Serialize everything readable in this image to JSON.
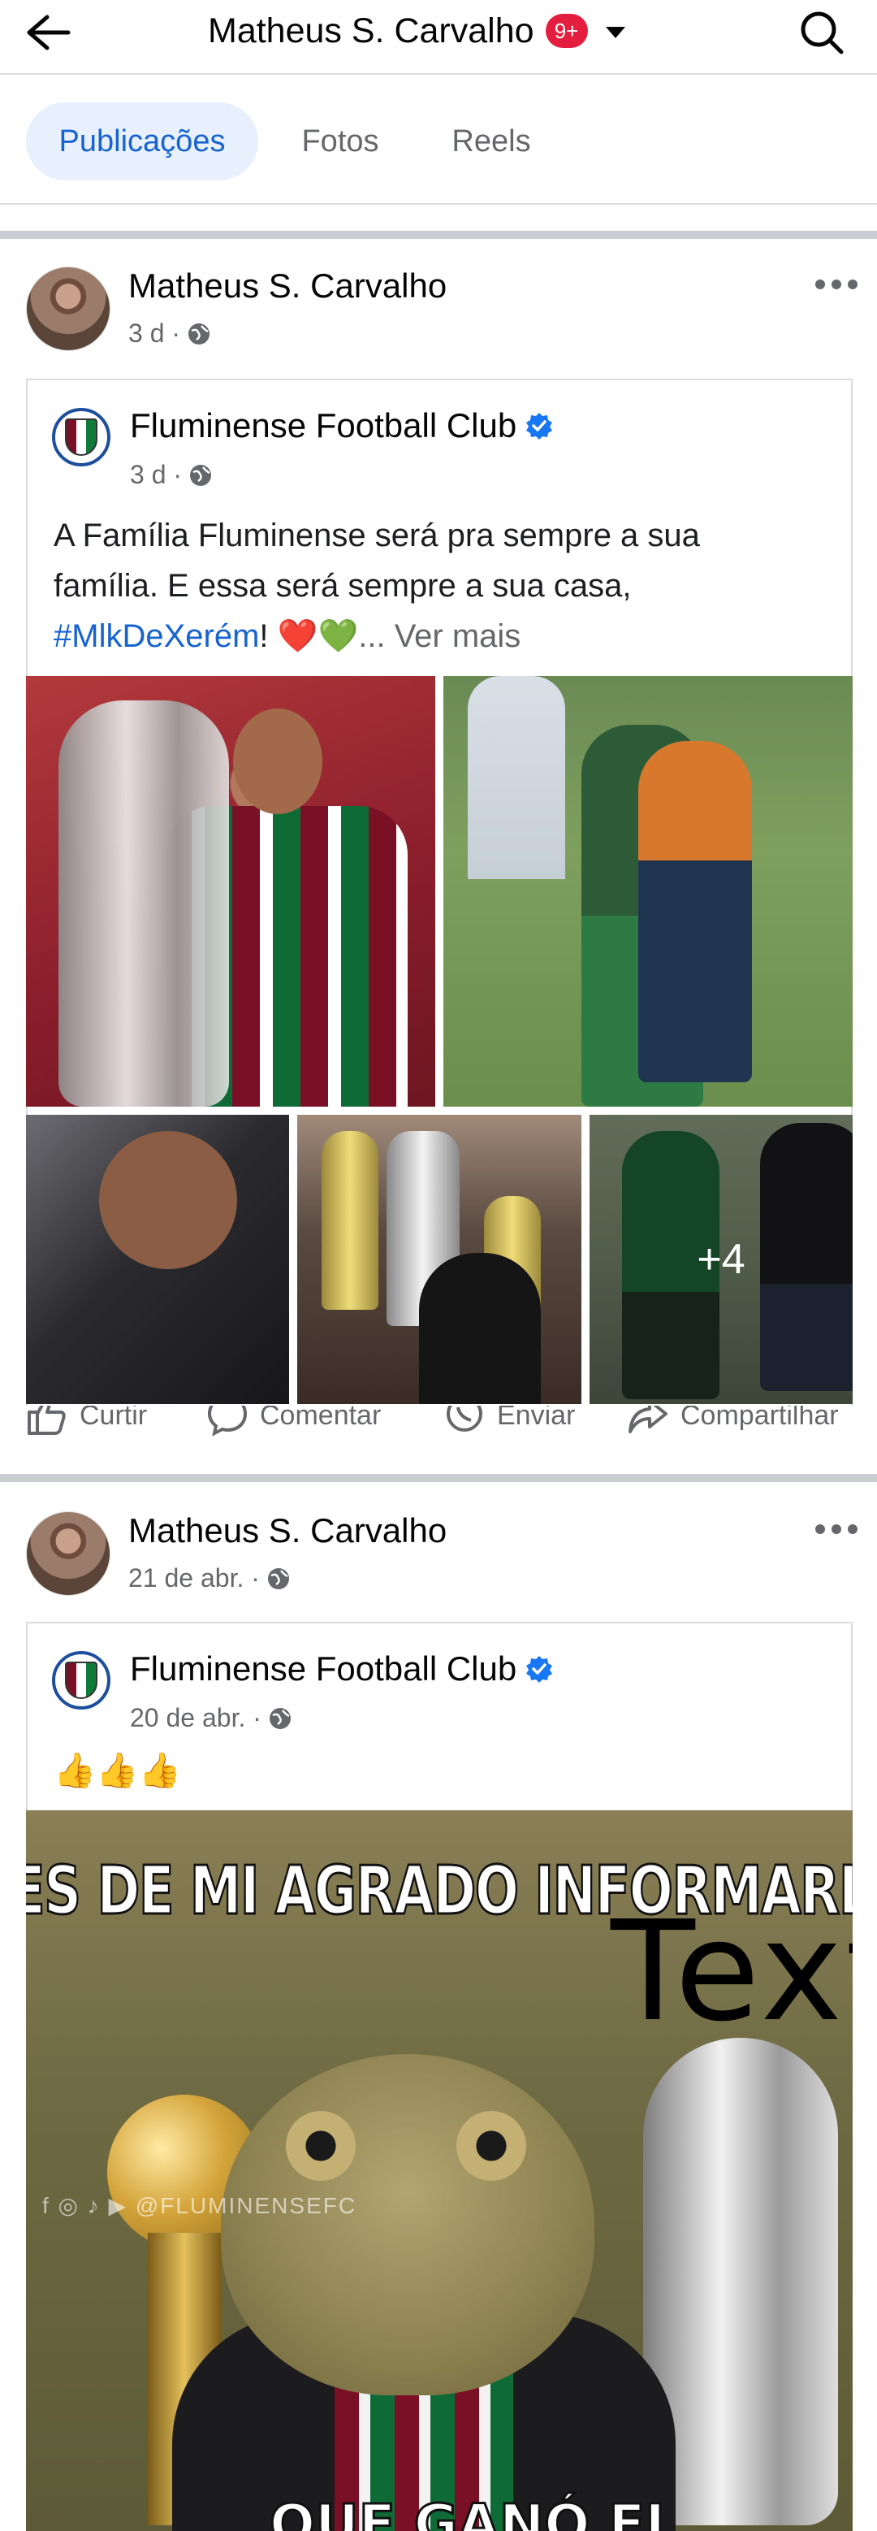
{
  "header": {
    "title": "Matheus S. Carvalho",
    "badge": "9+"
  },
  "tabs": [
    {
      "label": "Publicações",
      "active": true
    },
    {
      "label": "Fotos",
      "active": false
    },
    {
      "label": "Reels",
      "active": false
    }
  ],
  "posts": [
    {
      "author": "Matheus S. Carvalho",
      "time": "3 d ·",
      "shared": {
        "page": "Fluminense Football Club",
        "time": "3 d ·",
        "text_line1": "A Família Fluminense será pra sempre a sua",
        "text_line2": "família. E essa será sempre a sua casa,",
        "hashtag": "#MlkDeXerém",
        "after_hashtag": "! ❤️💚",
        "see_more": "... Ver mais",
        "more_photos": "+4"
      },
      "actions": [
        "Curtir",
        "Comentar",
        "Enviar",
        "Compartilhar"
      ]
    },
    {
      "author": "Matheus S. Carvalho",
      "time": "21 de abr. ·",
      "shared": {
        "page": "Fluminense Football Club",
        "time": "20 de abr. ·",
        "text": "👍👍👍",
        "meme_top": "ES DE MI AGRADO INFORMARLES",
        "meme_bottom": "QUE GANÓ EL",
        "meme_overlay": "Text",
        "watermark": "f ◎ ♪ ▶ @FLUMINENSEFC"
      }
    }
  ],
  "colors": {
    "accent": "#1763cf",
    "tab_active_bg": "#e7f0fc",
    "badge": "#e41e3f",
    "muted": "#65676b"
  },
  "icons": [
    "back-arrow-icon",
    "search-icon",
    "globe-icon",
    "verified-icon",
    "more-icon",
    "like-icon",
    "comment-icon",
    "whatsapp-icon",
    "share-icon"
  ]
}
